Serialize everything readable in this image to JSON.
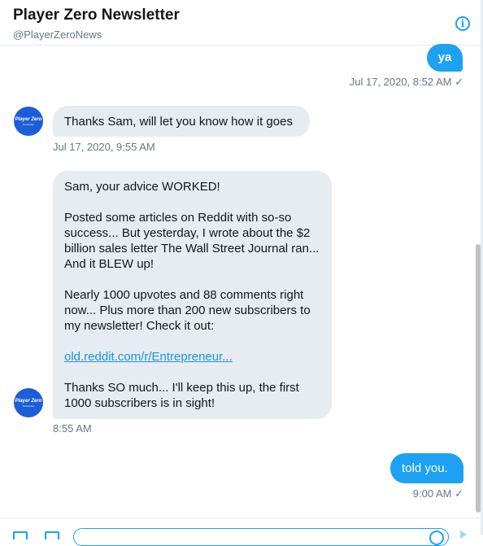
{
  "header": {
    "title": "Player Zero Newsletter",
    "handle": "@PlayerZeroNews",
    "info_icon": "info-icon",
    "info_glyph": "i"
  },
  "avatar": {
    "line1": "Player Zero",
    "line2": "Newsletter"
  },
  "messages": [
    {
      "direction": "outgoing",
      "text": "ya",
      "timestamp": "Jul 17, 2020, 8:52 AM ✓"
    },
    {
      "direction": "incoming",
      "text": "Thanks Sam, will let you know how it goes",
      "timestamp": "Jul 17, 2020, 9:55 AM"
    },
    {
      "direction": "incoming",
      "paragraphs": [
        "Sam, your advice WORKED!",
        "Posted some articles on Reddit with so-so success... But yesterday, I wrote about the $2 billion sales letter The Wall Street Journal ran... And it BLEW up!",
        "Nearly 1000 upvotes and 88 comments right now... Plus more than 200 new subscribers to my newsletter! Check it out:",
        "old.reddit.com/r/Entrepreneur...",
        "Thanks SO much... I'll keep this up, the first 1000 subscribers is in sight!"
      ],
      "timestamp": "8:55 AM"
    },
    {
      "direction": "outgoing",
      "text": "told you.",
      "timestamp": "9:00 AM ✓"
    }
  ],
  "composer": {
    "icons": [
      "image-icon",
      "gif-icon",
      "emoji-icon",
      "send-icon"
    ]
  },
  "colors": {
    "accent": "#1da1f2",
    "incoming_bubble": "#e6ecf0",
    "link": "#1b95e0",
    "muted_text": "#657786"
  }
}
